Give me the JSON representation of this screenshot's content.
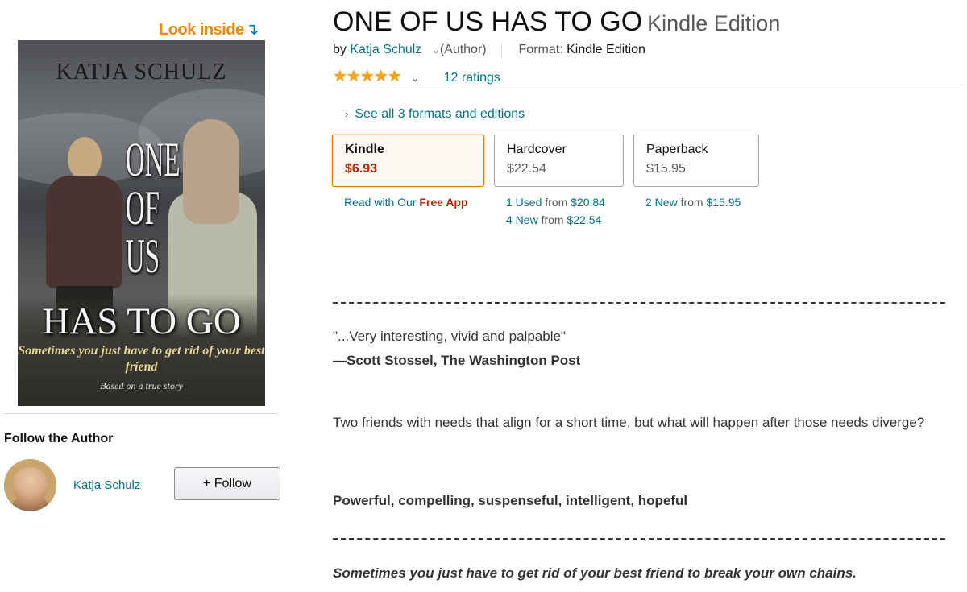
{
  "look_inside": {
    "label": "Look inside",
    "arrow": "↴"
  },
  "cover": {
    "author": "KATJA SCHULZ",
    "title_line1": "ONE",
    "title_line2": "OF",
    "title_line3": "US",
    "title_line4": "HAS TO GO",
    "tagline": "Sometimes you just have to get rid of your best friend",
    "footer": "Based on a true story"
  },
  "follow": {
    "heading": "Follow the Author",
    "author_name": "Katja Schulz",
    "button_label": "+ Follow"
  },
  "product": {
    "title": "ONE OF US HAS TO GO",
    "edition": "Kindle Edition",
    "by_prefix": "by",
    "author": "Katja Schulz",
    "author_chevron": "⌄",
    "author_role": "(Author)",
    "format_label": "Format:",
    "format_value": "Kindle Edition",
    "stars": "★★★★★",
    "rating": 5,
    "ratings_chevron": "⌄",
    "ratings_text": "12 ratings",
    "see_all": "See all 3 formats and editions",
    "see_all_chevron": "›"
  },
  "formats": [
    {
      "name": "Kindle",
      "price": "$6.93",
      "selected": true
    },
    {
      "name": "Hardcover",
      "price": "$22.54",
      "selected": false
    },
    {
      "name": "Paperback",
      "price": "$15.95",
      "selected": false
    }
  ],
  "format_subs": {
    "kindle": {
      "prefix": "Read with Our",
      "emph": "Free App"
    },
    "hardcover": [
      {
        "count": "1 Used",
        "from": "from",
        "price": "$20.84"
      },
      {
        "count": "4 New",
        "from": "from",
        "price": "$22.54"
      }
    ],
    "paperback": [
      {
        "count": "2 New",
        "from": "from",
        "price": "$15.95"
      }
    ]
  },
  "description": {
    "quote": "\"...Very interesting, vivid and palpable\"",
    "quote_source": "—Scott Stossel, The Washington Post",
    "paragraph": "Two friends with needs that align for a short time, but what will happen after those needs diverge?",
    "bold_line": "Powerful, compelling, suspenseful, intelligent, hopeful",
    "italic_line": "Sometimes you just have to get rid of your best friend to break your own chains."
  },
  "colors": {
    "link": "#007185",
    "price_red": "#b12704",
    "star": "#f4a41d",
    "selected_border": "#e77600",
    "look_inside_orange": "#f08804"
  }
}
